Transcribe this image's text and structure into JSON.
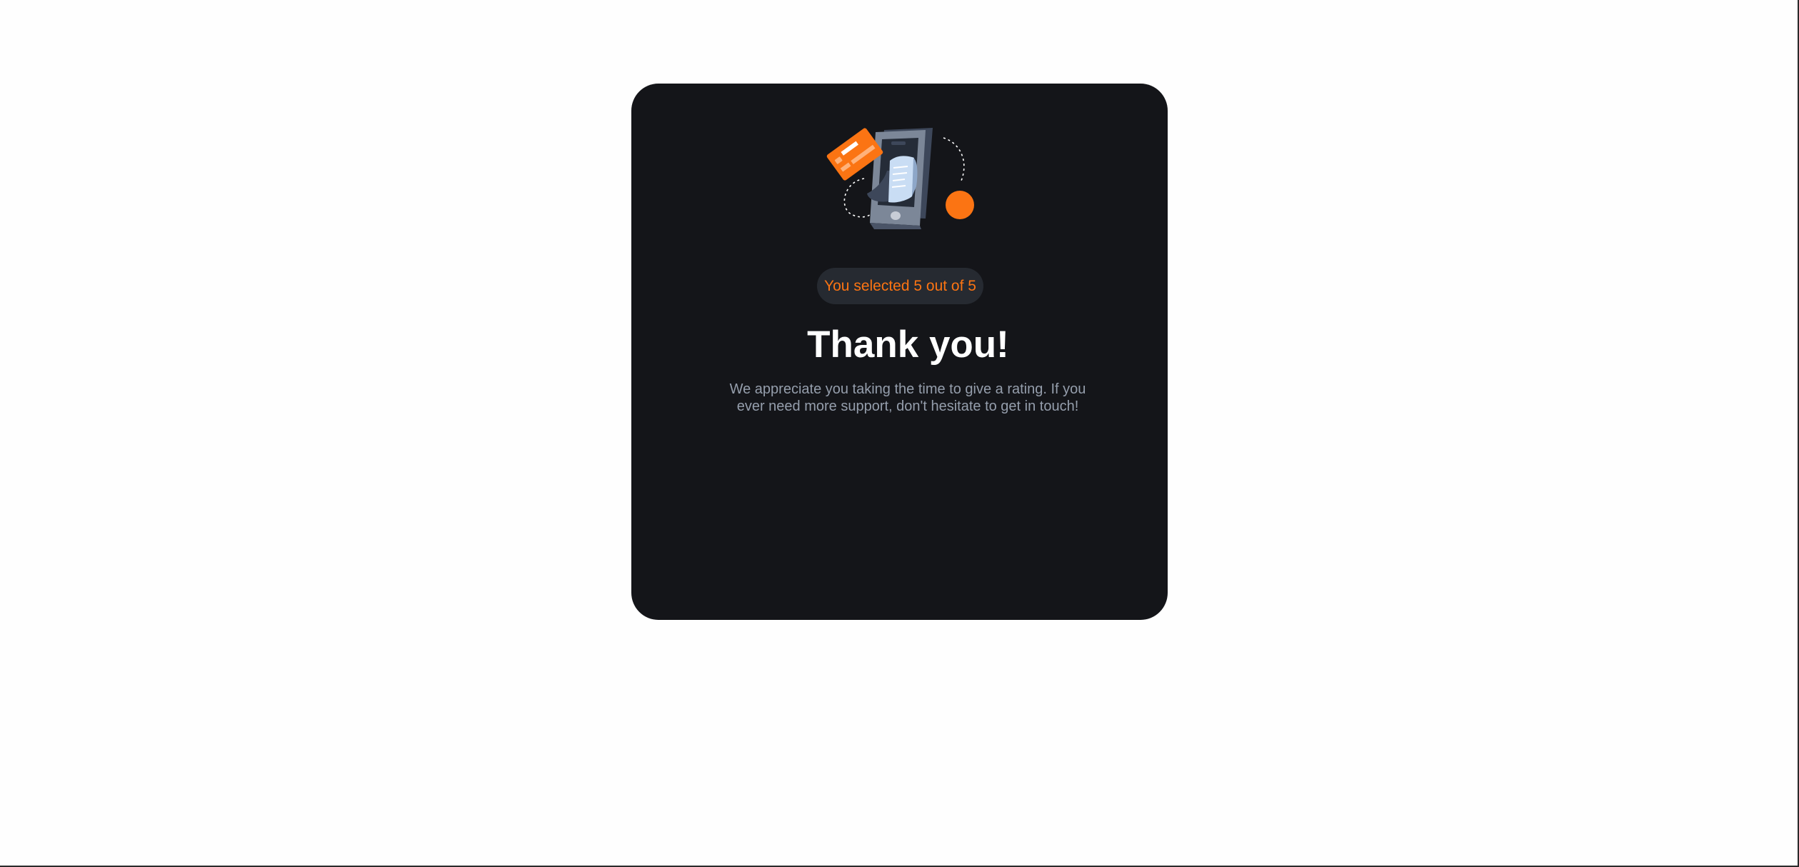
{
  "thank_you_card": {
    "illustration_icon": "phone-receipt-card-illustration",
    "selection_text": "You selected 5 out of 5",
    "selected_rating": 5,
    "max_rating": 5,
    "title": "Thank you!",
    "message": "We appreciate you taking the time to give a rating. If you ever need more support, don't hesitate to get in touch!"
  },
  "colors": {
    "page_background": "#fefefe",
    "card_background": "#141519",
    "badge_background": "#262a31",
    "accent_orange": "#fb7413",
    "title_text": "#ffffff",
    "body_text": "#959eac",
    "phone_body": "#7c8798"
  }
}
